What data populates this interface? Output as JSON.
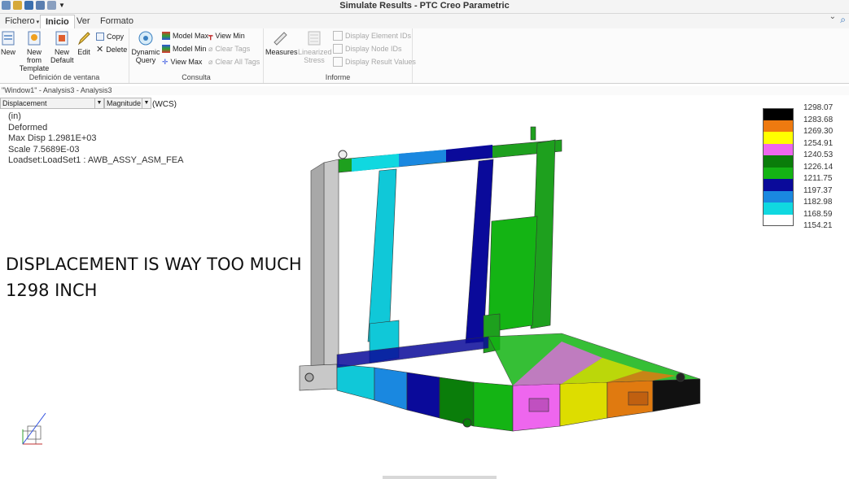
{
  "window": {
    "title": "Simulate Results - PTC Creo Parametric"
  },
  "tabs": [
    {
      "label": "Fichero",
      "has_menu": true
    },
    {
      "label": "Inicio",
      "active": true
    },
    {
      "label": "Ver"
    },
    {
      "label": "Formato"
    }
  ],
  "ribbon": {
    "groups": [
      {
        "label": "Definición de ventana",
        "buttons": [
          {
            "label1": "New",
            "label2": ""
          },
          {
            "label1": "New from",
            "label2": "Template"
          },
          {
            "label1": "New",
            "label2": "Default"
          },
          {
            "label1": "Edit",
            "label2": ""
          }
        ],
        "small": [
          {
            "label": "Copy"
          },
          {
            "label": "Delete"
          }
        ]
      },
      {
        "label": "Consulta",
        "buttons": [
          {
            "label1": "Dynamic",
            "label2": "Query"
          }
        ],
        "small": [
          {
            "label": "Model Max"
          },
          {
            "label": "Model Min"
          },
          {
            "label": "View Max"
          },
          {
            "label": "View Min"
          },
          {
            "label": "Clear Tags",
            "disabled": true
          },
          {
            "label": "Clear All Tags",
            "disabled": true
          }
        ]
      },
      {
        "label": "Informe",
        "buttons": [
          {
            "label1": "Measures",
            "label2": ""
          },
          {
            "label1": "Linearized",
            "label2": "Stress",
            "disabled": true
          }
        ],
        "small": [
          {
            "label": "Display Element IDs",
            "disabled": true
          },
          {
            "label": "Display Node IDs",
            "disabled": true
          },
          {
            "label": "Display Result Values",
            "disabled": true
          }
        ]
      }
    ]
  },
  "window_name": "\"Window1\" - Analysis3 - Analysis3",
  "result_selectors": {
    "quantity": "Displacement",
    "component": "Magnitude",
    "csys": "(WCS)"
  },
  "info_lines": [
    "(in)",
    "Deformed",
    "Max Disp  1.2981E+03",
    "Scale  7.5689E-03",
    "Loadset:LoadSet1 :   AWB_ASSY_ASM_FEA"
  ],
  "annotation": [
    "DISPLACEMENT IS WAY TOO MUCH",
    "1298 INCH"
  ],
  "legend": {
    "values": [
      "1298.07",
      "1283.68",
      "1269.30",
      "1254.91",
      "1240.53",
      "1226.14",
      "1211.75",
      "1197.37",
      "1182.98",
      "1168.59",
      "1154.21"
    ],
    "colors": [
      "#000000",
      "#ee7a10",
      "#ffff00",
      "#ee66ee",
      "#0a7d0a",
      "#14b414",
      "#0a0a9a",
      "#1a88e0",
      "#10d8e0",
      "#ffffff"
    ]
  },
  "colors": {
    "accent_tab": "#ffffff",
    "gray_frame": "#c8c8c8"
  }
}
